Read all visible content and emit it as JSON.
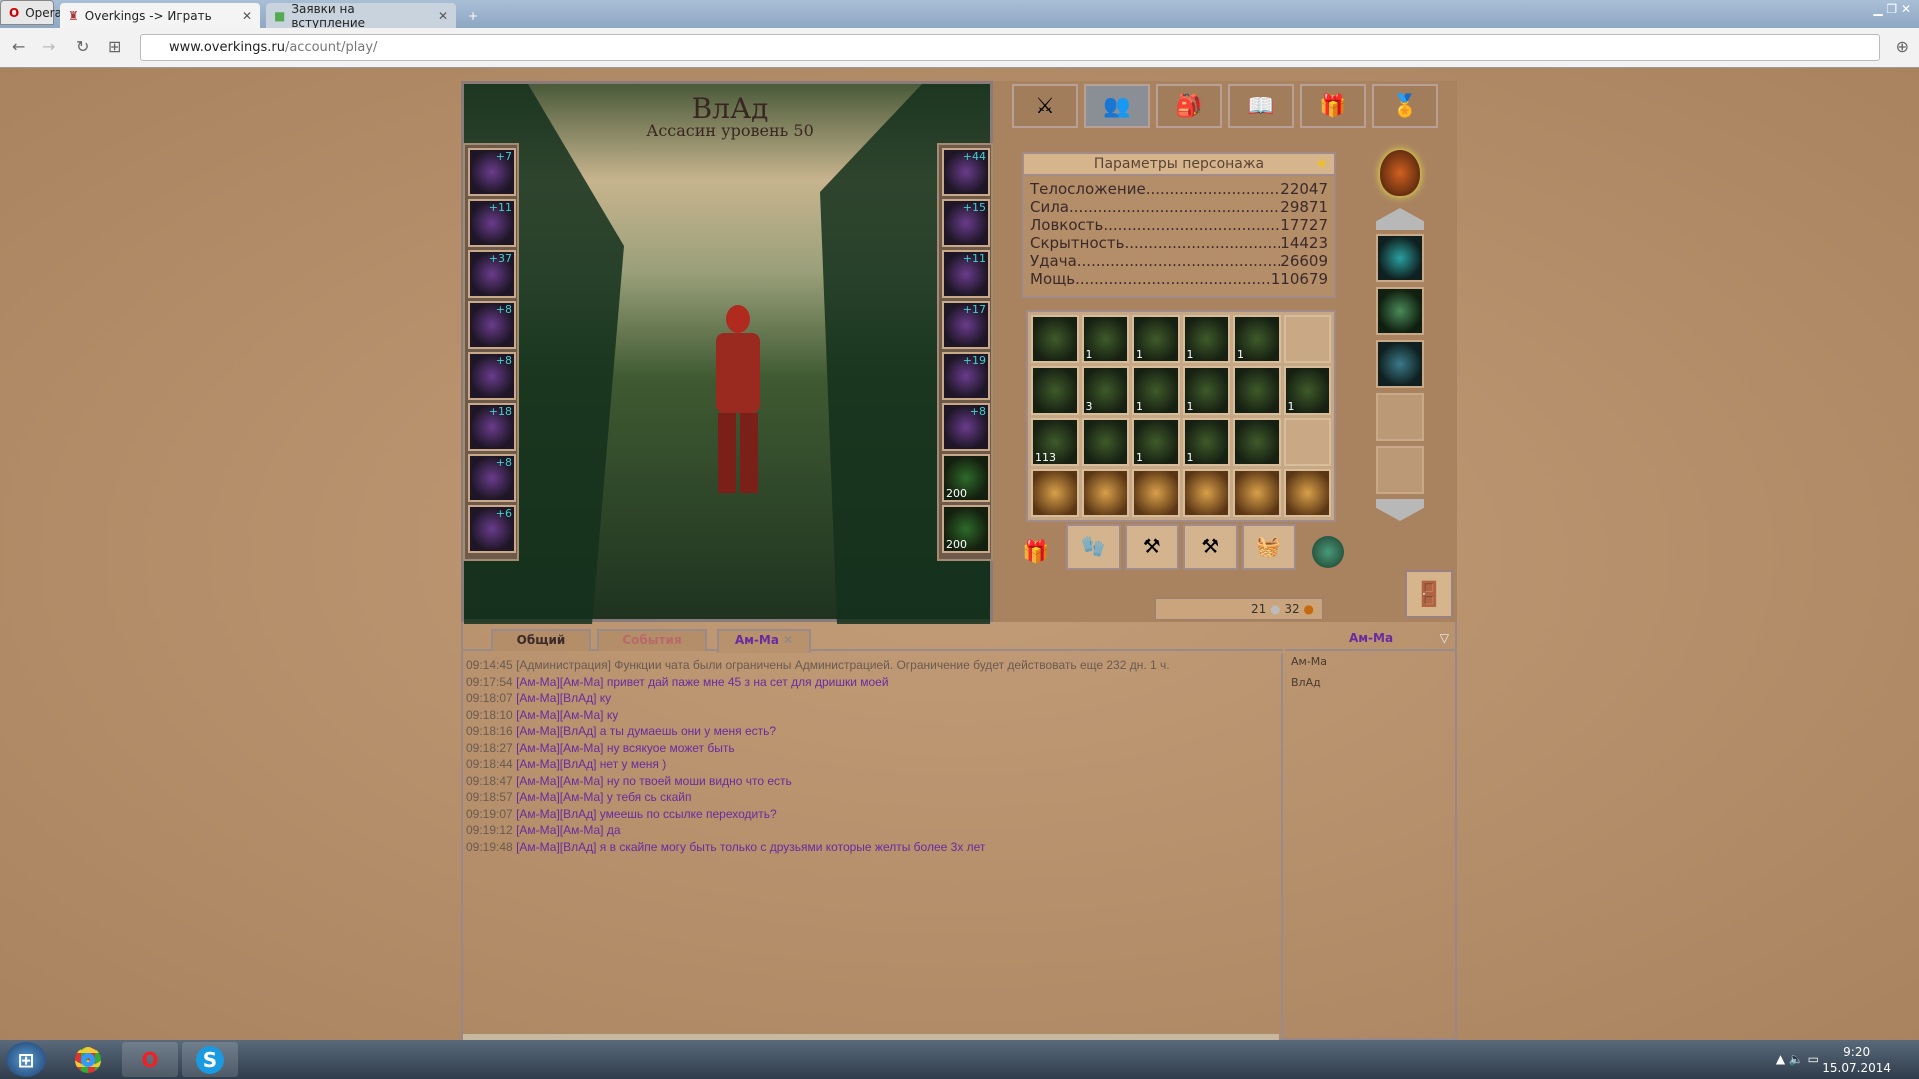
{
  "browser": {
    "menu_label": "Opera",
    "tabs": [
      {
        "label": "Overkings -> Играть",
        "active": true
      },
      {
        "label": "Заявки на вступление",
        "active": false
      }
    ],
    "url_domain": "www.overkings.ru",
    "url_path": "/account/play/"
  },
  "character": {
    "name": "ВлАд",
    "subtitle": "Ассасин уровень 50"
  },
  "left_slots": [
    {
      "item": "hood",
      "bonus": "+7"
    },
    {
      "item": "helmet",
      "bonus": "+11"
    },
    {
      "item": "bracer",
      "bonus": "+37"
    },
    {
      "item": "shoulder",
      "bonus": "+8"
    },
    {
      "item": "gloves",
      "bonus": "+8"
    },
    {
      "item": "pants",
      "bonus": "+18"
    },
    {
      "item": "belt",
      "bonus": "+8"
    },
    {
      "item": "boots",
      "bonus": "+6"
    }
  ],
  "right_slots": [
    {
      "item": "dagger",
      "bonus": "+44"
    },
    {
      "item": "dagger",
      "bonus": "+15"
    },
    {
      "item": "amulet",
      "bonus": "+11"
    },
    {
      "item": "ring",
      "bonus": "+17"
    },
    {
      "item": "ring",
      "bonus": "+19"
    },
    {
      "item": "belt",
      "bonus": "+8"
    },
    {
      "item": "green-potion",
      "count": "200"
    },
    {
      "item": "green-flask",
      "count": "200"
    }
  ],
  "top_tabs": [
    "battle",
    "characters",
    "inventory",
    "spellbook",
    "gifts",
    "clan"
  ],
  "stats": {
    "title": "Параметры персонажа",
    "rows": [
      {
        "label": "Телосложение",
        "value": "22047"
      },
      {
        "label": "Сила",
        "value": "29871"
      },
      {
        "label": "Ловкость",
        "value": "17727"
      },
      {
        "label": "Скрытность",
        "value": "14423"
      },
      {
        "label": "Удача",
        "value": "26609"
      },
      {
        "label": "Мощь",
        "value": "110679"
      }
    ]
  },
  "inventory": [
    {
      "t": "cloak"
    },
    {
      "t": "crystals",
      "c": "1"
    },
    {
      "t": "flask",
      "c": "1"
    },
    {
      "t": "fire-ore",
      "c": "1"
    },
    {
      "t": "hammer",
      "c": "1"
    },
    {
      "t": "empty"
    },
    {
      "t": "cloak"
    },
    {
      "t": "scroll",
      "c": "3"
    },
    {
      "t": "bar",
      "c": "1"
    },
    {
      "t": "glove",
      "c": "1"
    },
    {
      "t": "cloak"
    },
    {
      "t": "staff",
      "c": "1"
    },
    {
      "t": "silver",
      "c": "113"
    },
    {
      "t": "cloak"
    },
    {
      "t": "potion",
      "c": "1"
    },
    {
      "t": "magnifier",
      "c": "1"
    },
    {
      "t": "cloak"
    },
    {
      "t": "empty"
    },
    {
      "t": "bag"
    },
    {
      "t": "bag"
    },
    {
      "t": "bag"
    },
    {
      "t": "bag"
    },
    {
      "t": "bag"
    },
    {
      "t": "bag"
    }
  ],
  "tools": [
    "hide",
    "anvil",
    "anvil",
    "basket"
  ],
  "currency": {
    "silver": "21",
    "gold": "32"
  },
  "chat": {
    "tabs": [
      "Общий",
      "События",
      "Ам-Ма"
    ],
    "active_tab": "Ам-Ма",
    "messages": [
      {
        "time": "09:14:45",
        "text": "[Администрация] Функции чата были ограничены Администрацией. Ограничение будет действовать еще 232 дн. 1 ч.",
        "sys": true
      },
      {
        "time": "09:17:54",
        "text": "[Ам-Ма][Ам-Ма] привет дай паже мне  45 з на сет для дришки моей"
      },
      {
        "time": "09:18:07",
        "text": "[Ам-Ма][ВлАд] ку"
      },
      {
        "time": "09:18:10",
        "text": "[Ам-Ма][Ам-Ма] ку"
      },
      {
        "time": "09:18:16",
        "text": "[Ам-Ма][ВлАд] а ты думаешь они у меня есть?"
      },
      {
        "time": "09:18:27",
        "text": "[Ам-Ма][Ам-Ма] ну всякуое может быть"
      },
      {
        "time": "09:18:44",
        "text": "[Ам-Ма][ВлАд] нет у меня )"
      },
      {
        "time": "09:18:47",
        "text": "[Ам-Ма][Ам-Ма] ну по твоей моши видно что есть"
      },
      {
        "time": "09:18:57",
        "text": "[Ам-Ма][Ам-Ма] у тебя сь скайп"
      },
      {
        "time": "09:19:07",
        "text": "[Ам-Ма][ВлАд] умеешь по ссылке переходить?"
      },
      {
        "time": "09:19:12",
        "text": "[Ам-Ма][Ам-Ма] да"
      },
      {
        "time": "09:19:48",
        "text": "[Ам-Ма][ВлАд] я в скайпе могу быть только с друзьями которые желты более 3х лет"
      }
    ]
  },
  "userlist": {
    "title": "Ам-Ма",
    "users": [
      "Ам-Ма",
      "ВлАд"
    ]
  },
  "taskbar": {
    "time": "9:20",
    "date": "15.07.2014"
  }
}
